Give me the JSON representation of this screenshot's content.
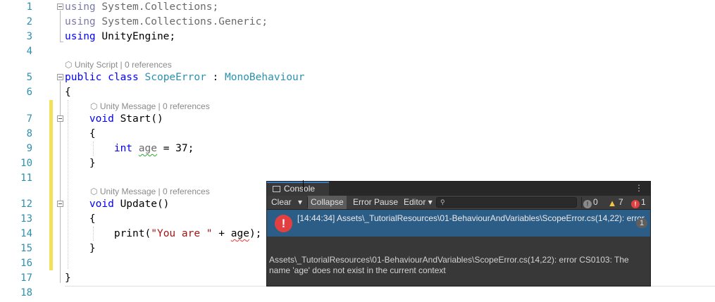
{
  "editor": {
    "line_numbers": [
      "1",
      "2",
      "3",
      "4",
      "5",
      "6",
      "7",
      "8",
      "9",
      "10",
      "11",
      "12",
      "13",
      "14",
      "15",
      "16",
      "17",
      "18"
    ],
    "lines": {
      "l1_kw": "using",
      "l1_rest": " System.Collections;",
      "l2_kw": "using",
      "l2_rest": " System.Collections.Generic;",
      "l3_kw": "using",
      "l3_rest": " UnityEngine;",
      "l5_kw1": "public",
      "l5_kw2": " class ",
      "l5_type": "ScopeError",
      "l5_colon": " : ",
      "l5_base": "MonoBehaviour",
      "l6": "{",
      "l7_indent": "    ",
      "l7_kw": "void",
      "l7_rest": " Start()",
      "l8": "    {",
      "l9_indent": "        ",
      "l9_kw": "int",
      "l9_sp": " ",
      "l9_var": "age",
      "l9_rest": " = 37;",
      "l10": "    }",
      "l12_indent": "    ",
      "l12_kw": "void",
      "l12_rest": " Update()",
      "l13": "    {",
      "l14_indent": "        ",
      "l14_pre": "print(",
      "l14_str": "\"You are \"",
      "l14_mid": " + ",
      "l14_var": "age",
      "l14_end": ");",
      "l15": "    }",
      "l17": "}"
    },
    "codelens": {
      "script": "Unity Script",
      "script_refs": "0 references",
      "message": "Unity Message",
      "message_refs": "0 references",
      "separator": "|"
    }
  },
  "console": {
    "tab_label": "Console",
    "menu_icon": "⋮",
    "toolbar": {
      "clear": "Clear",
      "collapse": "Collapse",
      "error_pause": "Error Pause",
      "editor": "Editor",
      "search_placeholder": ""
    },
    "counts": {
      "info": "0",
      "warnings": "7",
      "errors": "1"
    },
    "entries": [
      {
        "text": "[14:44:34] Assets\\_TutorialResources\\01-BehaviourAndVariables\\ScopeError.cs(14,22): error",
        "count": "1"
      }
    ],
    "detail": "Assets\\_TutorialResources\\01-BehaviourAndVariables\\ScopeError.cs(14,22): error CS0103: The name 'age' does not exist in the current context"
  },
  "colors": {
    "keyword": "#0000ff",
    "type": "#2b91af",
    "string": "#a31515",
    "console_bg": "#383838",
    "console_selected": "#2c5d87",
    "error": "#e24040",
    "warning": "#f5c542"
  }
}
